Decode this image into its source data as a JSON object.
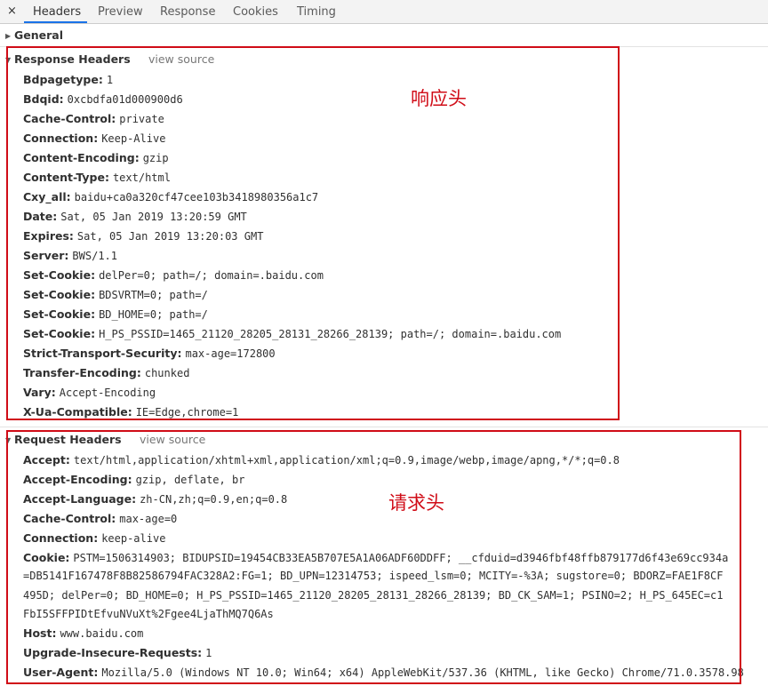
{
  "tabs": [
    "Headers",
    "Preview",
    "Response",
    "Cookies",
    "Timing"
  ],
  "close_glyph": "×",
  "general": {
    "title": "General"
  },
  "response_headers": {
    "title": "Response Headers",
    "view_source": "view source",
    "annotation": "响应头",
    "headers": [
      {
        "name": "Bdpagetype:",
        "value": "1"
      },
      {
        "name": "Bdqid:",
        "value": "0xcbdfa01d000900d6"
      },
      {
        "name": "Cache-Control:",
        "value": "private"
      },
      {
        "name": "Connection:",
        "value": "Keep-Alive"
      },
      {
        "name": "Content-Encoding:",
        "value": "gzip"
      },
      {
        "name": "Content-Type:",
        "value": "text/html"
      },
      {
        "name": "Cxy_all:",
        "value": "baidu+ca0a320cf47cee103b3418980356a1c7"
      },
      {
        "name": "Date:",
        "value": "Sat, 05 Jan 2019 13:20:59 GMT"
      },
      {
        "name": "Expires:",
        "value": "Sat, 05 Jan 2019 13:20:03 GMT"
      },
      {
        "name": "Server:",
        "value": "BWS/1.1"
      },
      {
        "name": "Set-Cookie:",
        "value": "delPer=0; path=/; domain=.baidu.com"
      },
      {
        "name": "Set-Cookie:",
        "value": "BDSVRTM=0; path=/"
      },
      {
        "name": "Set-Cookie:",
        "value": "BD_HOME=0; path=/"
      },
      {
        "name": "Set-Cookie:",
        "value": "H_PS_PSSID=1465_21120_28205_28131_28266_28139; path=/; domain=.baidu.com"
      },
      {
        "name": "Strict-Transport-Security:",
        "value": "max-age=172800"
      },
      {
        "name": "Transfer-Encoding:",
        "value": "chunked"
      },
      {
        "name": "Vary:",
        "value": "Accept-Encoding"
      },
      {
        "name": "X-Ua-Compatible:",
        "value": "IE=Edge,chrome=1"
      }
    ]
  },
  "request_headers": {
    "title": "Request Headers",
    "view_source": "view source",
    "annotation": "请求头",
    "accept": {
      "name": "Accept:",
      "value": "text/html,application/xhtml+xml,application/xml;q=0.9,image/webp,image/apng,*/*;q=0.8"
    },
    "accept_encoding": {
      "name": "Accept-Encoding:",
      "value": "gzip, deflate, br"
    },
    "accept_language": {
      "name": "Accept-Language:",
      "value": "zh-CN,zh;q=0.9,en;q=0.8"
    },
    "cache_control": {
      "name": "Cache-Control:",
      "value": "max-age=0"
    },
    "connection": {
      "name": "Connection:",
      "value": "keep-alive"
    },
    "cookie": {
      "name": "Cookie:",
      "value": "PSTM=1506314903; BIDUPSID=19454CB33EA5B707E5A1A06ADF60DDFF; __cfduid=d3946fbf48ffb879177d6f43e69cc934a",
      "cont1": "=DB5141F167478F8B82586794FAC328A2:FG=1; BD_UPN=12314753; ispeed_lsm=0; MCITY=-%3A; sugstore=0; BDORZ=FAE1F8CF",
      "cont2": "495D; delPer=0; BD_HOME=0; H_PS_PSSID=1465_21120_28205_28131_28266_28139; BD_CK_SAM=1; PSINO=2; H_PS_645EC=c1",
      "cont3": "FbI5SFFPIDtEfvuNVuXt%2Fgee4LjaThMQ7Q6As"
    },
    "host": {
      "name": "Host:",
      "value": "www.baidu.com"
    },
    "upgrade": {
      "name": "Upgrade-Insecure-Requests:",
      "value": "1"
    },
    "user_agent": {
      "name": "User-Agent:",
      "value": "Mozilla/5.0 (Windows NT 10.0; Win64; x64) AppleWebKit/537.36 (KHTML, like Gecko) Chrome/71.0.3578.98"
    }
  },
  "colors": {
    "annotation_red": "#d00c17",
    "tab_accent": "#1a73e8"
  }
}
